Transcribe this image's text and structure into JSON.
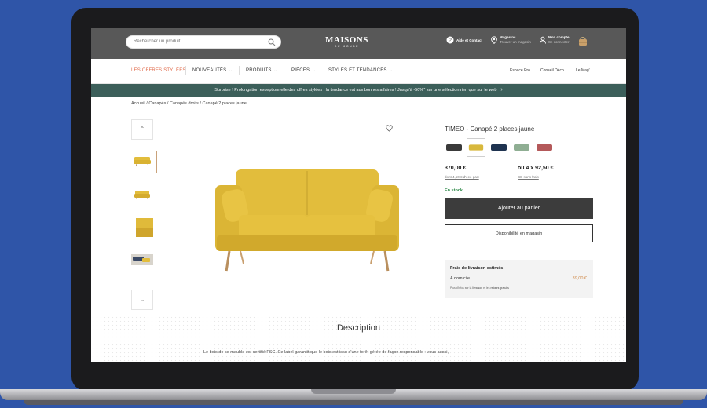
{
  "header": {
    "search_placeholder": "Rechercher un produit...",
    "logo_line1": "MAISONS",
    "logo_line2": "DU MONDE",
    "help_label": "Aide et Contact",
    "store_label": "Magasins",
    "store_sub": "Trouver un magasin",
    "account_label": "Mon compte",
    "account_sub": "Se connecter"
  },
  "nav": {
    "items": [
      {
        "label": "LES OFFRES STYLÉES"
      },
      {
        "label": "NOUVEAUTÉS"
      },
      {
        "label": "PRODUITS"
      },
      {
        "label": "PIÈCES"
      },
      {
        "label": "STYLES ET TENDANCES"
      }
    ],
    "right": [
      "Espace Pro",
      "Conseil Déco",
      "Le Mag'"
    ]
  },
  "promo": {
    "text": "Surprise ! Prolongation exceptionnelle des offres stylées : la tendance est aux bonnes affaires ! Jusqu'à -50%* sur une sélection rien que sur le web"
  },
  "breadcrumb": "Accueil / Canapés / Canapés droits / Canapé 2 places jaune",
  "product": {
    "title": "TIMEO - Canapé 2 places jaune",
    "price": "370,00 €",
    "price_installments": "ou 4 x 92,50 €",
    "points_link": "dont 4,50 € d'éco-part",
    "installment_link": "CB sans frais",
    "stock": "En stock",
    "add_to_cart": "Ajouter au panier",
    "store_availability": "Disponibilité en magasin",
    "swatch_colors": [
      "#3a3a3a",
      "#d8b83c",
      "#1e3350",
      "#8fae93",
      "#b4595a"
    ]
  },
  "delivery": {
    "title": "Frais de livraison estimés",
    "method": "A domicile",
    "price": "39,00 €",
    "note_prefix": "Plus d'infos sur la",
    "note_link1": "livraison",
    "note_mid": "et les",
    "note_link2": "retours gratuits"
  },
  "description": {
    "title": "Description",
    "text": "Le bois de ce meuble est certifié FSC. Ce label garantit que le bois est issu d'une forêt gérée de façon responsable : vous aussi,"
  },
  "colors": {
    "header_bg": "#585858",
    "promo_bg": "#3c5f5a",
    "accent": "#e06a4a",
    "sofa": "#e2bd3c"
  }
}
